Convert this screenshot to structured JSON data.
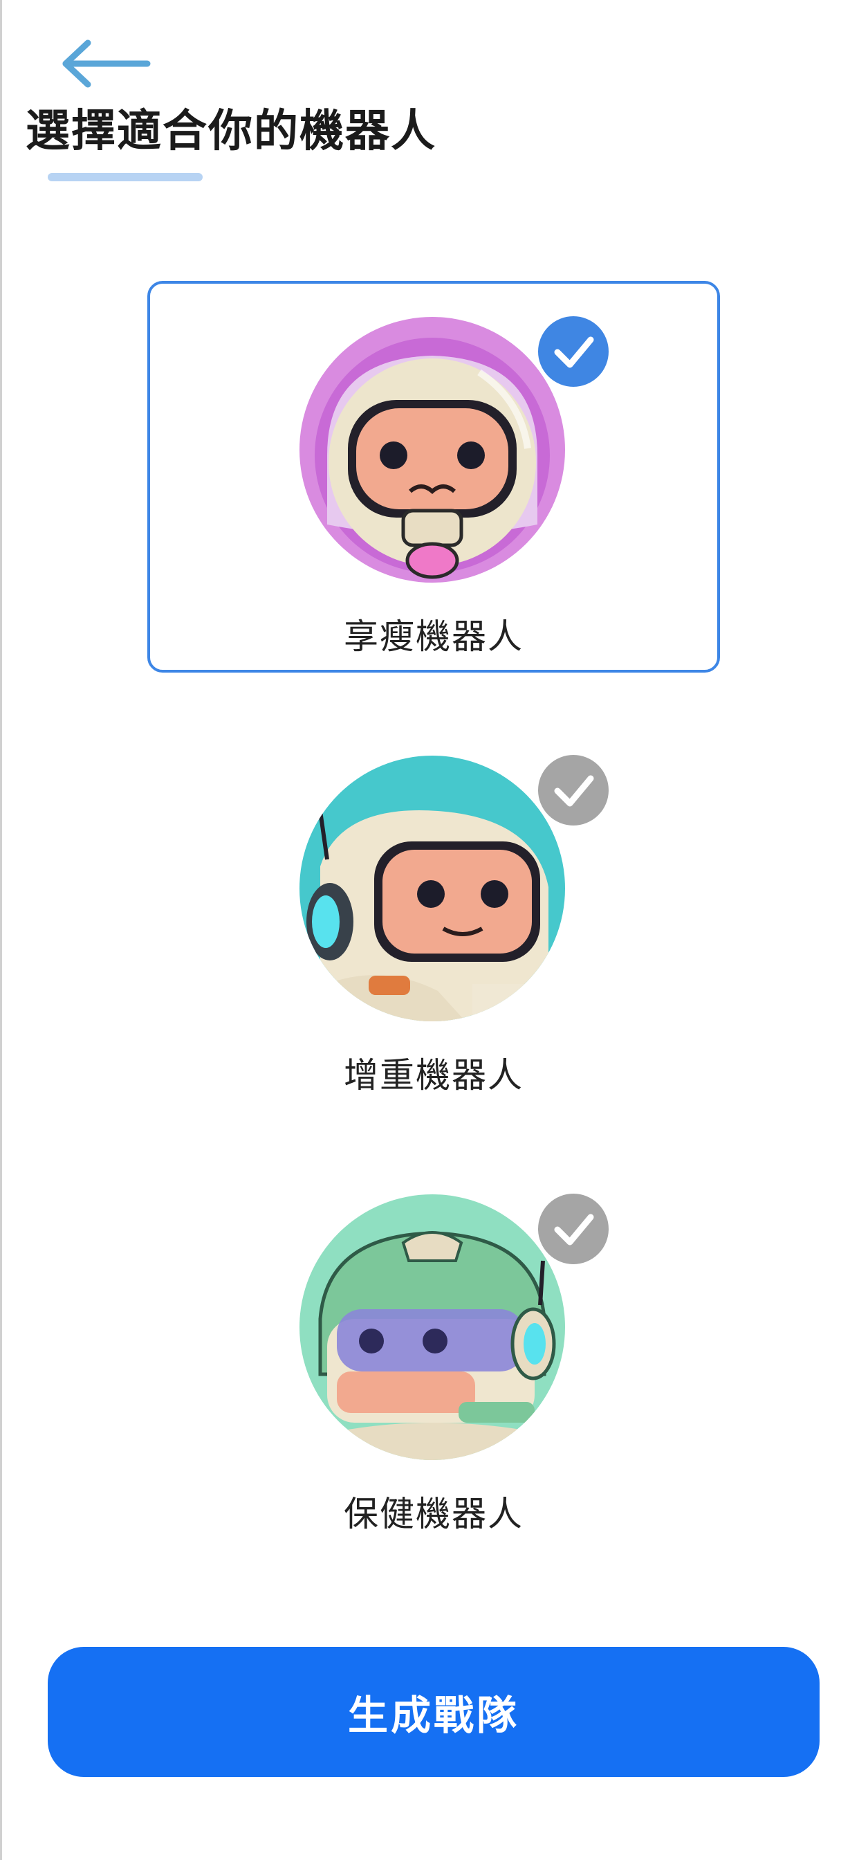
{
  "header": {
    "back_icon": "arrow-left-icon",
    "title": "選擇適合你的機器人"
  },
  "colors": {
    "accent": "#1570f3",
    "selected_border": "#3d86e6",
    "check_on": "#3f86e3",
    "check_off": "#a5a5a5",
    "title_underline": "#b7d3f3"
  },
  "robots": [
    {
      "label": "享瘦機器人",
      "selected": true,
      "avatar_bg": "#d98be0",
      "helmet": "#ebe3c8"
    },
    {
      "label": "增重機器人",
      "selected": false,
      "avatar_bg": "#46c8cc",
      "helmet": "#efe6cf"
    },
    {
      "label": "保健機器人",
      "selected": false,
      "avatar_bg": "#8fdfc1",
      "helmet": "#7cc79a"
    }
  ],
  "footer": {
    "generate_label": "生成戰隊"
  }
}
